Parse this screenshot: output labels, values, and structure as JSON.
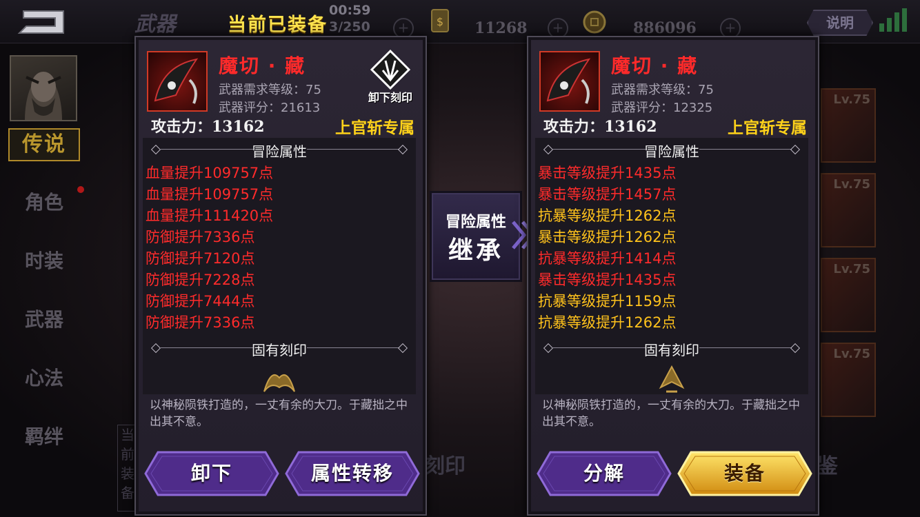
{
  "top": {
    "title": "武器",
    "time": "00:59",
    "count": "3/250",
    "current_label": "当前已装备",
    "currency1": "11268",
    "currency2": "886096",
    "help": "说明",
    "plus": "+"
  },
  "nav": {
    "active": "传说",
    "items": [
      "角色",
      "时装",
      "武器",
      "心法",
      "羁绊"
    ]
  },
  "bg": {
    "card_level": "Lv.75",
    "btn_seal": "刻印",
    "btn_appraise": "鉴",
    "side_text": "当前装备"
  },
  "left": {
    "name": "魔切 · 藏",
    "req": "武器需求等级：75",
    "score": "武器评分：21613",
    "attack": "攻击力：13162",
    "exclusive": "上官斩专属",
    "unseal": "卸下刻印",
    "adv_title": "冒险属性",
    "attrs": [
      {
        "text": "血量提升109757点",
        "color": "#ff2b2b"
      },
      {
        "text": "血量提升109757点",
        "color": "#ff2b2b"
      },
      {
        "text": "血量提升111420点",
        "color": "#ff2b2b"
      },
      {
        "text": "防御提升7336点",
        "color": "#ff2b2b"
      },
      {
        "text": "防御提升7120点",
        "color": "#ff2b2b"
      },
      {
        "text": "防御提升7228点",
        "color": "#ff2b2b"
      },
      {
        "text": "防御提升7444点",
        "color": "#ff2b2b"
      },
      {
        "text": "防御提升7336点",
        "color": "#ff2b2b"
      }
    ],
    "seal_title": "固有刻印",
    "desc": "以神秘陨铁打造的，一丈有余的大刀。于藏拙之中出其不意。",
    "btn1": "卸下",
    "btn2": "属性转移"
  },
  "right": {
    "name": "魔切 · 藏",
    "req": "武器需求等级：75",
    "score": "武器评分：12325",
    "attack": "攻击力：13162",
    "exclusive": "上官斩专属",
    "adv_title": "冒险属性",
    "attrs": [
      {
        "text": "暴击等级提升1435点",
        "color": "#ff2b2b"
      },
      {
        "text": "暴击等级提升1457点",
        "color": "#ff2b2b"
      },
      {
        "text": "抗暴等级提升1262点",
        "color": "#ffc21c"
      },
      {
        "text": "暴击等级提升1262点",
        "color": "#ffc21c"
      },
      {
        "text": "抗暴等级提升1414点",
        "color": "#ff2b2b"
      },
      {
        "text": "暴击等级提升1435点",
        "color": "#ff2b2b"
      },
      {
        "text": "抗暴等级提升1159点",
        "color": "#ffc21c"
      },
      {
        "text": "抗暴等级提升1262点",
        "color": "#ffc21c"
      }
    ],
    "seal_title": "固有刻印",
    "desc": "以神秘陨铁打造的，一丈有余的大刀。于藏拙之中出其不意。",
    "btn1": "分解",
    "btn2": "装备"
  },
  "inherit": {
    "line1": "冒险属性",
    "line2": "继承"
  },
  "colors": {
    "accent_gold": "#ffd21a",
    "attr_red": "#ff2b2b",
    "attr_gold": "#ffc21c",
    "panel": "#2a2431"
  }
}
